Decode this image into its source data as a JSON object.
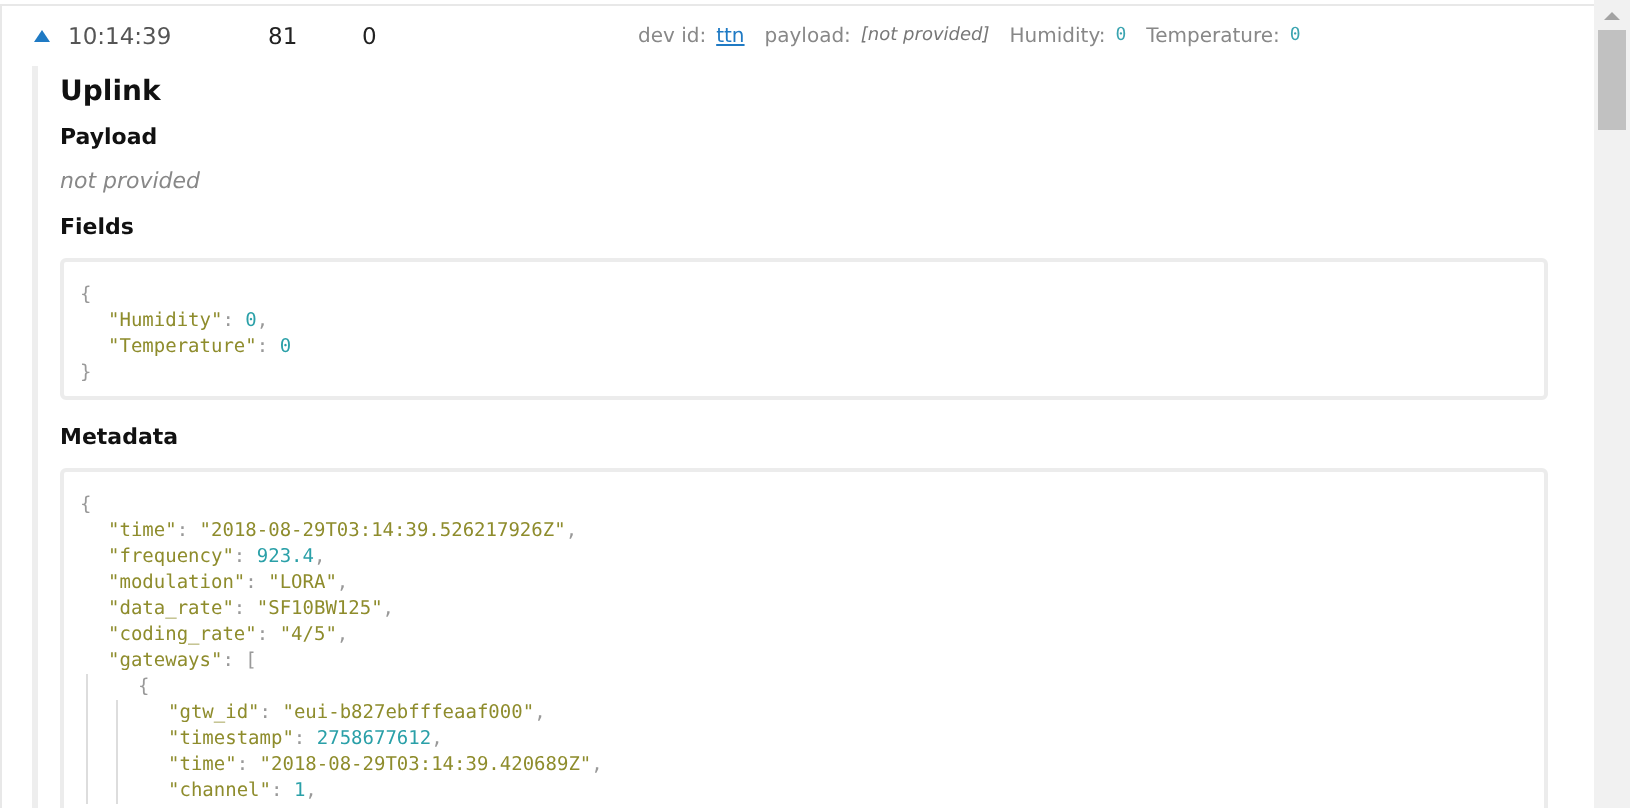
{
  "entry": {
    "expanded": true,
    "time": "10:14:39",
    "counter": "81",
    "port": "0",
    "fields": [
      {
        "label": "dev id:",
        "value": "ttn",
        "kind": "link"
      },
      {
        "label": "payload:",
        "value": "[not provided]",
        "kind": "italic"
      },
      {
        "label": "Humidity:",
        "value": "0",
        "kind": "code"
      },
      {
        "label": "Temperature:",
        "value": "0",
        "kind": "code"
      }
    ]
  },
  "detail": {
    "title": "Uplink",
    "sections": [
      {
        "heading": "Payload",
        "kind": "note",
        "text": "not provided"
      },
      {
        "heading": "Fields",
        "kind": "code",
        "lines": [
          "{",
          "  \"Humidity\": 0,",
          "  \"Temperature\": 0",
          "}"
        ]
      },
      {
        "heading": "Metadata",
        "kind": "code",
        "lines": [
          "{",
          "  \"time\": \"2018-08-29T03:14:39.526217926Z\",",
          "  \"frequency\": 923.4,",
          "  \"modulation\": \"LORA\",",
          "  \"data_rate\": \"SF10BW125\",",
          "  \"coding_rate\": \"4/5\",",
          "  \"gateways\": [",
          "    {",
          "      \"gtw_id\": \"eui-b827ebfffeaaf000\",",
          "      \"timestamp\": 2758677612,",
          "      \"time\": \"2018-08-29T03:14:39.420689Z\",",
          "      \"channel\": 1,"
        ]
      }
    ]
  }
}
